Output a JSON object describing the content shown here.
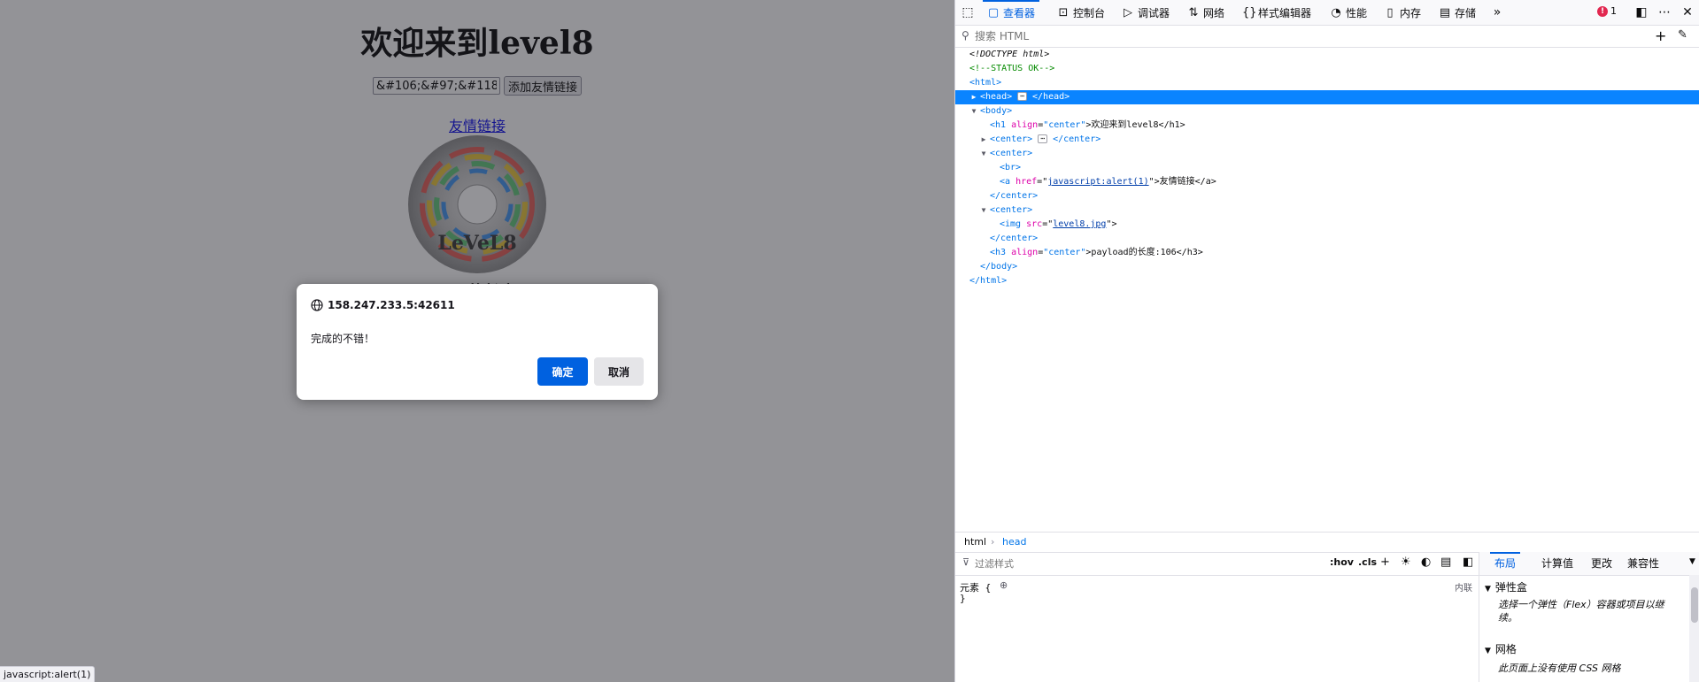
{
  "page": {
    "title": "欢迎来到level8",
    "keyword_value": "&#106;&#97;&#118;&#",
    "submit_label": "添加友情链接",
    "link_label": "友情链接",
    "image_text": "LeVeL8",
    "payload_length": "payload的长度:106"
  },
  "alert": {
    "origin": "158.247.233.5:42611",
    "message": "完成的不错！",
    "ok_label": "确定",
    "cancel_label": "取消"
  },
  "status_bar": {
    "url": "javascript:alert(1)"
  },
  "devtools": {
    "tabs": [
      {
        "label": "查看器",
        "icon": "inspector-icon",
        "active": true
      },
      {
        "label": "控制台",
        "icon": "console-icon"
      },
      {
        "label": "调试器",
        "icon": "debugger-icon"
      },
      {
        "label": "网络",
        "icon": "network-icon"
      },
      {
        "label": "样式编辑器",
        "icon": "style-editor-icon"
      },
      {
        "label": "性能",
        "icon": "performance-icon"
      },
      {
        "label": "内存",
        "icon": "memory-icon"
      },
      {
        "label": "存储",
        "icon": "storage-icon"
      }
    ],
    "error_count": "1",
    "search_placeholder": "搜索 HTML",
    "markup": {
      "doctype": "<!DOCTYPE html>",
      "comment": "<!--STATUS OK-->",
      "html_open": "<html>",
      "head_open": "<head>",
      "head_close": "</head>",
      "body_open": "<body>",
      "h1_open": "<h1",
      "h1_attr": "align",
      "h1_val": "\"center\"",
      "h1_text": ">欢迎来到level8</h1>",
      "center1_open": "<center>",
      "center1_close": "</center>",
      "center2_open": "<center>",
      "br": "<br>",
      "a_open": "<a",
      "a_attr": "href",
      "a_val": "javascript:alert(1)",
      "a_text": "\">友情链接</a>",
      "center2_close": "</center>",
      "center3_open": "<center>",
      "img_open": "<img",
      "img_attr": "src",
      "img_val": "level8.jpg",
      "img_close": "\">",
      "center3_close": "</center>",
      "h3_open": "<h3",
      "h3_attr": "align",
      "h3_val": "\"center\"",
      "h3_text": ">payload的长度:106</h3>",
      "body_close": "</body>",
      "html_close": "</html>"
    },
    "breadcrumb": [
      "html",
      "head"
    ],
    "rules": {
      "filter_placeholder": "过滤样式",
      "hov": ":hov",
      "cls": ".cls",
      "element_rule": "元素 {",
      "element_close": "}",
      "inline_label": "内联"
    },
    "side": {
      "tabs": [
        "布局",
        "计算值",
        "更改",
        "兼容性"
      ],
      "flex_title": "弹性盒",
      "flex_body": "选择一个弹性（Flex）容器或项目以继续。",
      "grid_title": "网格",
      "grid_body": "此页面上没有使用 CSS 网格"
    }
  }
}
